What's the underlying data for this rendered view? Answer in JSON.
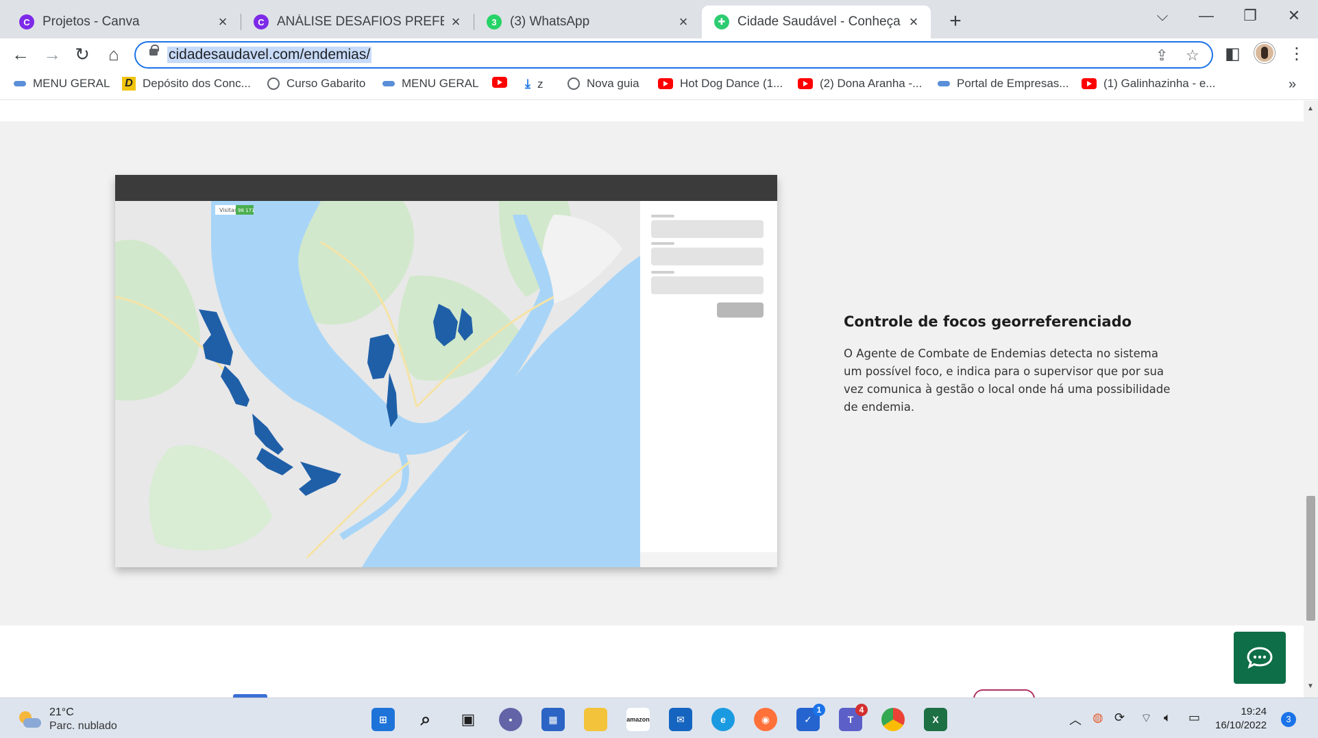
{
  "browser": {
    "tabs": [
      {
        "title": "Projetos - Canva",
        "favicon": "canva-icon",
        "color": "#7d2ae8"
      },
      {
        "title": "ANÁLISE DESAFIOS PREFEITURA",
        "favicon": "canva-icon",
        "color": "#7d2ae8"
      },
      {
        "title": "(3) WhatsApp",
        "favicon": "whatsapp-icon",
        "color": "#25d366",
        "badge": "3"
      },
      {
        "title": "Cidade Saudável - Conheça o sist",
        "favicon": "cidade-saudavel-icon",
        "color": "#2ecc71",
        "active": true
      }
    ],
    "url": "cidadesaudavel.com/endemias/",
    "bookmarks": [
      {
        "label": "MENU GERAL",
        "icon": "menu-geral-icon"
      },
      {
        "label": "Depósito dos Conc...",
        "icon": "deposito-icon"
      },
      {
        "label": "Curso Gabarito",
        "icon": "globe-icon"
      },
      {
        "label": "MENU GERAL",
        "icon": "menu-geral-icon"
      },
      {
        "label": "",
        "icon": "youtube-icon"
      },
      {
        "label": "z",
        "icon": "download-icon"
      },
      {
        "label": "Nova guia",
        "icon": "globe-icon"
      },
      {
        "label": "Hot Dog Dance (1...",
        "icon": "youtube-icon"
      },
      {
        "label": "(2) Dona Aranha -...",
        "icon": "youtube-icon"
      },
      {
        "label": "Portal de Empresas...",
        "icon": "menu-geral-icon"
      },
      {
        "label": "(1) Galinhazinha - e...",
        "icon": "youtube-icon"
      }
    ]
  },
  "section": {
    "title": "Controle de focos georreferenciado",
    "description": "O Agente de Combate de Endemias detecta no sistema um possível foco, e indica para o supervisor que por sua vez comunica à gestão o local onde há uma possibilidade de endemia."
  },
  "map": {
    "tag_label": "Visitas",
    "tag_value": "98 171"
  },
  "taskbar": {
    "temperature": "21°C",
    "condition": "Parc. nublado",
    "time": "19:24",
    "date": "16/10/2022",
    "notifications": "3",
    "apps": [
      {
        "name": "windows-start-icon"
      },
      {
        "name": "search-icon"
      },
      {
        "name": "task-view-icon"
      },
      {
        "name": "chat-icon"
      },
      {
        "name": "store-icon"
      },
      {
        "name": "file-explorer-icon"
      },
      {
        "name": "amazon-icon"
      },
      {
        "name": "mail-icon"
      },
      {
        "name": "edge-icon"
      },
      {
        "name": "firefox-icon"
      },
      {
        "name": "todo-icon",
        "badge": "1"
      },
      {
        "name": "teams-icon",
        "badge": "4"
      },
      {
        "name": "chrome-icon"
      },
      {
        "name": "excel-icon"
      }
    ]
  },
  "colors": {
    "accent": "#1a73e8",
    "section_bg": "#f1f1f1",
    "chat_button": "#0e6e47",
    "map_water": "#a8d5f7",
    "map_land": "#e8e8e8",
    "map_green": "#cfe8c8",
    "map_focus": "#1f5fa8"
  }
}
